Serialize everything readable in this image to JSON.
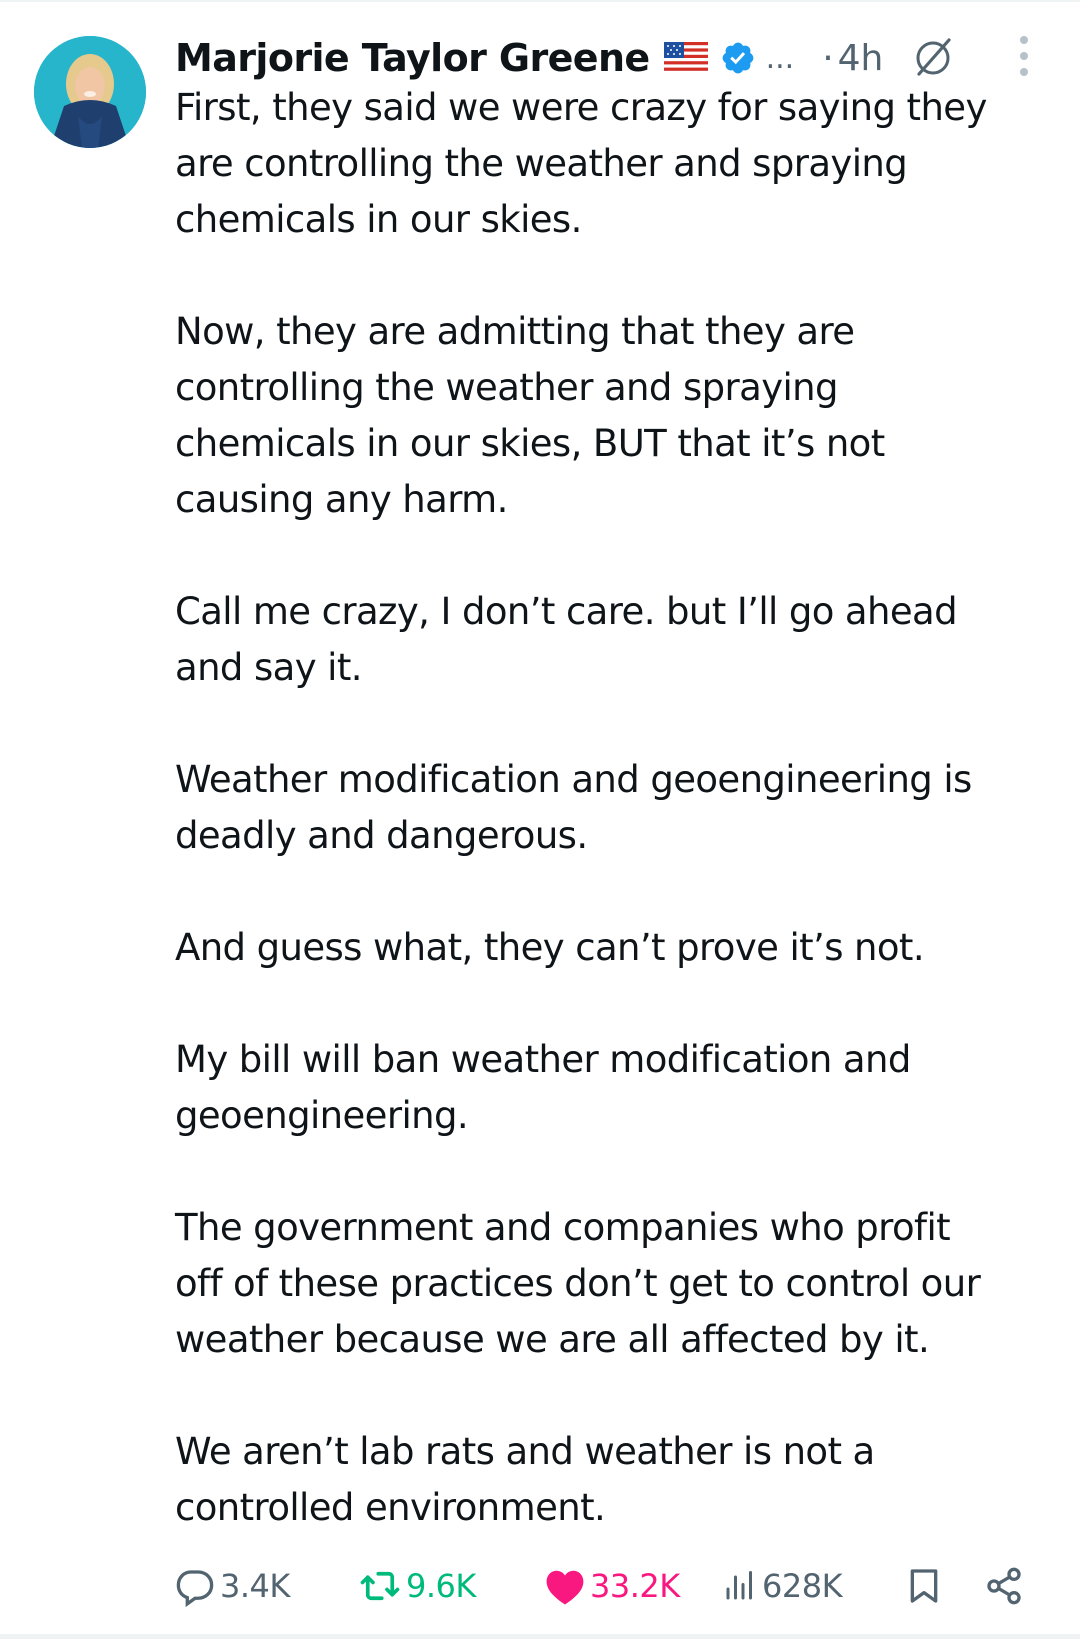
{
  "post": {
    "author": {
      "display_name": "Marjorie Taylor Greene",
      "handle_truncated": "...",
      "flag_icon": "us-flag-icon",
      "verified_icon": "verified-badge-icon",
      "verified_color": "#1d9bf0"
    },
    "separator": "·",
    "timestamp": "4h",
    "paragraphs": [
      [
        "First, they said we were crazy for saying they",
        "are controlling the weather and spraying",
        "chemicals in our skies."
      ],
      [
        "Now, they are admitting that they are",
        "controlling the weather and spraying",
        "chemicals in our skies, BUT that it’s not",
        "causing any harm."
      ],
      [
        "Call me crazy, I don’t care. but I’ll go ahead",
        "and say it."
      ],
      [
        "Weather modification and geoengineering is",
        "deadly and dangerous."
      ],
      [
        "And guess what, they can’t prove it’s not."
      ],
      [
        "My bill will ban weather modification and",
        "geoengineering."
      ],
      [
        "The government and companies who profit",
        "off of these practices don’t get to control our",
        "weather because we are all affected by it."
      ],
      [
        "We aren’t lab rats and weather is not a",
        "controlled environment."
      ]
    ],
    "actions": {
      "replies": "3.4K",
      "reposts": "9.6K",
      "likes": "33.2K",
      "views": "628K"
    },
    "colors": {
      "text": "#0f1419",
      "muted": "#536471",
      "repost_active": "#00ba7c",
      "like_active": "#f91880"
    }
  }
}
